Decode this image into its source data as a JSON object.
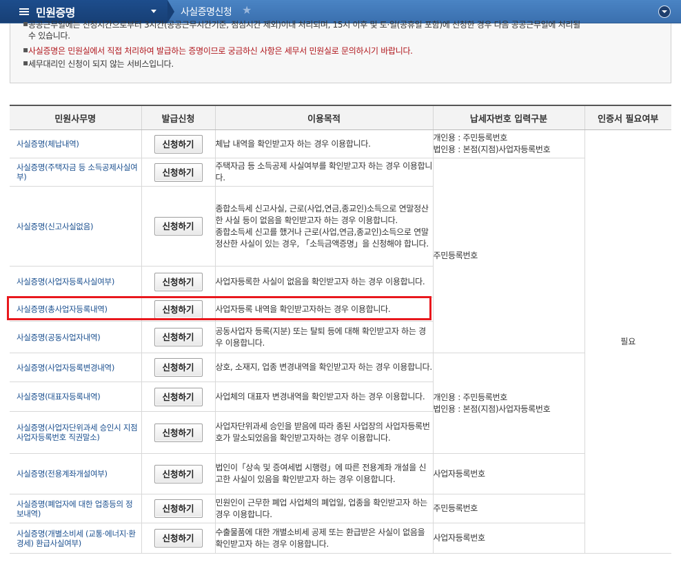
{
  "nav": {
    "menu_title": "민원증명",
    "breadcrumb": "사실증명신청",
    "star_icon": "star-icon",
    "colors": {
      "bar": "#3a6fae",
      "menu": "#173f75"
    }
  },
  "notice": {
    "line1": "공공근무일에는 신청시간으로부터 3시간(공공근무시간기준, 점심시간 제외)이내 처리되며, 15시 이후 및 토·일(공휴일 포함)에 신청한 경우 다음 공공근무일에 처리될",
    "line1b": "수 있습니다.",
    "line2": "사실증명은 민원실에서 직접 처리하여 발급하는 증명이므로 궁금하신 사항은 세무서 민원실로 문의하시기 바랍니다.",
    "line3": "세무대리인 신청이 되지 않는 서비스입니다."
  },
  "table": {
    "headers": [
      "민원사무명",
      "발급신청",
      "이용목적",
      "납세자번호 입력구분",
      "인증서 필요여부"
    ],
    "apply_label": "신청하기",
    "cert_required": "필요",
    "rows": [
      {
        "name": "사실증명(체납내역)",
        "purpose": "체납 내역을 확인받고자 하는 경우 이용합니다."
      },
      {
        "name": "사실증명(주택자금 등 소득공제사실여부)",
        "purpose": "주택자금 등 소득공제 사실여부를 확인받고자 하는 경우 이용합니다."
      },
      {
        "name": "사실증명(신고사실없음)",
        "purpose": "종합소득세 신고사실, 근로(사업,연금,종교인)소득으로 연말정산한 사실 등이 없음을 확인받고자 하는 경우 이용합니다.",
        "purpose2": "종합소득세 신고를 했거나 근로(사업,연금,종교인)소득으로 연말정산한 사실이 있는 경우, 「소득금액증명」을 신청해야 합니다."
      },
      {
        "name": "사실증명(사업자등록사실여부)",
        "purpose": "사업자등록한 사실이 없음을 확인받고자 하는 경우 이용합니다."
      },
      {
        "name": "사실증명(총사업자등록내역)",
        "purpose": "사업자등록 내역을 확인받고자하는 경우 이용합니다."
      },
      {
        "name": "사실증명(공동사업자내역)",
        "purpose": "공동사업자 등록(지분) 또는 탈퇴 등에 대해 확인받고자 하는 경우 이용합니다."
      },
      {
        "name": "사실증명(사업자등록변경내역)",
        "purpose": "상호, 소재지, 업종 변경내역을 확인받고자 하는 경우 이용합니다."
      },
      {
        "name": "사실증명(대표자등록내역)",
        "purpose": "사업체의 대표자 변경내역을 확인받고자 하는 경우 이용합니다."
      },
      {
        "name": "사실증명(사업자단위과세 승인시 지점사업자등록번호 직권말소)",
        "purpose": "사업자단위과세 승인을 받음에 따라 종된 사업장의 사업자등록번호가 말소되었음을 확인받고자하는 경우 이용합니다."
      },
      {
        "name": "사실증명(전용계좌개설여부)",
        "purpose": "법인이「상속 및 증여세법 시행령」에 따른 전용계좌 개설을 신고한 사실이 있음을 확인받고자 하는 경우 이용합니다."
      },
      {
        "name": "사실증명(폐업자에 대한 업종등의 정보내역)",
        "purpose": "민원인이 근무한 폐업 사업체의 폐업일, 업종을 확인받고자 하는 경우 이용합니다."
      },
      {
        "name": "사실증명(개별소비세 (교통·에너지·환경세) 환급사실여부)",
        "purpose": "수출물품에 대한 개별소비세 공제 또는 환급받은 사실이 없음을 확인받고자 하는 경우 이용합니다."
      }
    ],
    "taxid": {
      "both_personal": "개인용 : 주민등록번호",
      "both_corp": "법인용 : 본점(지점)사업자등록번호",
      "resident": "주민등록번호",
      "business": "사업자등록번호"
    }
  },
  "highlight": {
    "color": "#e8171c",
    "row": "사실증명(총사업자등록내역)"
  }
}
